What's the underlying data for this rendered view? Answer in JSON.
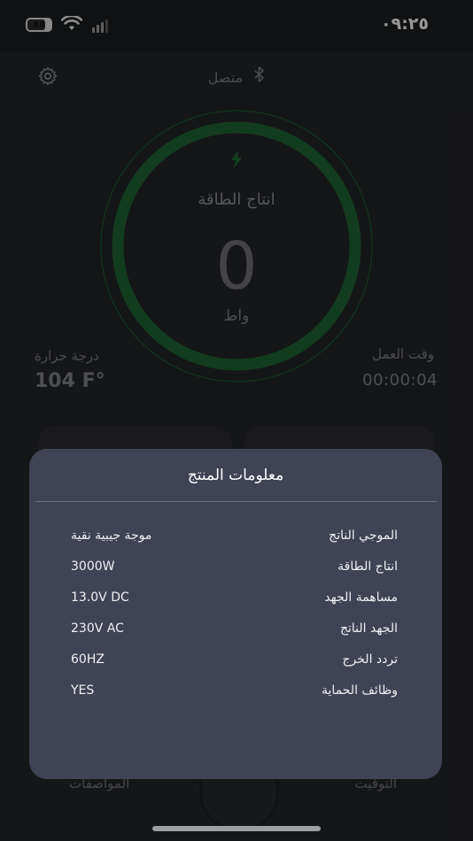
{
  "status_bar": {
    "time": "٠٩:٢٥",
    "battery": "٨٥"
  },
  "header": {
    "connection": "متصل"
  },
  "gauge": {
    "label": "انتاج الطاقة",
    "value": "0",
    "unit": "واط"
  },
  "stats": {
    "temperature_label": "درجة حرارة",
    "temperature_value": "104 F°",
    "work_time_label": "وقت العمل",
    "work_time_value": "00:00:04"
  },
  "tabs": {
    "left": "المواصفات",
    "right": "التوقيت"
  },
  "modal": {
    "title": "معلومات المنتج",
    "rows": [
      {
        "label": "الموجي الناتج",
        "value": "موجة جيبية نقية"
      },
      {
        "label": "انتاج الطاقة",
        "value": "3000W"
      },
      {
        "label": "مساهمة الجهد",
        "value": "13.0V DC"
      },
      {
        "label": "الجهد الناتج",
        "value": "230V AC"
      },
      {
        "label": "تردد الخرج",
        "value": "60HZ"
      },
      {
        "label": "وظائف الحماية",
        "value": "YES"
      }
    ]
  },
  "colors": {
    "background": "#1b1c1e",
    "modal": "#3f4353",
    "gauge_ring": "#1f6b35",
    "accent_green": "#2e7d44"
  },
  "icons": {
    "settings": "gear-icon",
    "bluetooth": "bluetooth-icon",
    "bolt": "bolt-icon",
    "wifi": "wifi-icon",
    "signal": "signal-icon",
    "battery": "battery-icon"
  }
}
